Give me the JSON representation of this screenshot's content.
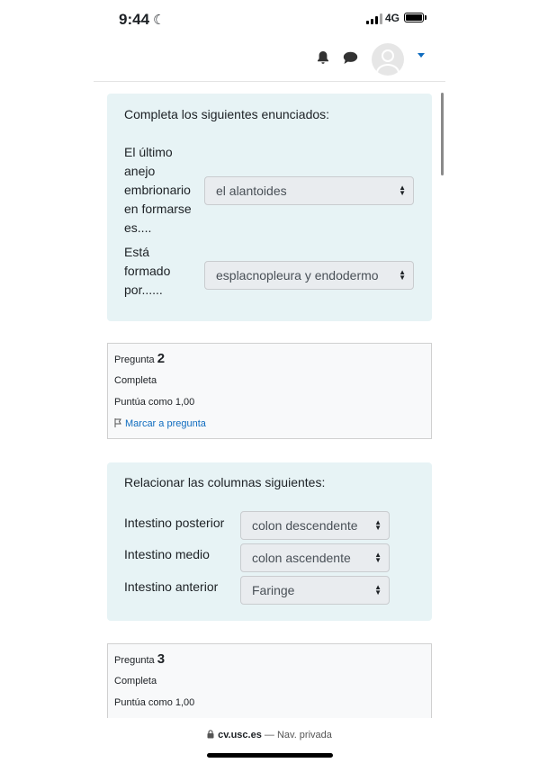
{
  "status_bar": {
    "time": "9:44",
    "network": "4G"
  },
  "icons": {
    "moon": "moon-icon",
    "bell": "bell-icon",
    "chat": "chat-bubble-icon",
    "lock": "lock-icon"
  },
  "question1": {
    "prompt": "Completa los siguientes enunciados:",
    "rows": [
      {
        "label_lines": [
          "El último",
          "anejo",
          "embrionario",
          "en formarse",
          "es...."
        ],
        "selected": "el alantoides"
      },
      {
        "label_lines": [
          "Está",
          "formado",
          "por......"
        ],
        "selected": "esplacnopleura y endodermo"
      }
    ]
  },
  "question2_info": {
    "prefix": "Pregunta",
    "number": "2",
    "state": "Completa",
    "grade": "Puntúa como 1,00",
    "flag_label": "Marcar a pregunta"
  },
  "question2": {
    "prompt": "Relacionar las columnas siguientes:",
    "rows": [
      {
        "label": "Intestino posterior",
        "selected": "colon descendente"
      },
      {
        "label": "Intestino medio",
        "selected": "colon ascendente"
      },
      {
        "label": "Intestino anterior",
        "selected": "Faringe"
      }
    ]
  },
  "question3_info": {
    "prefix": "Pregunta",
    "number": "3",
    "state": "Completa",
    "grade": "Puntúa como 1,00"
  },
  "browser": {
    "domain": "cv.usc.es",
    "suffix": "— Nav. privada"
  },
  "colors": {
    "accent": "#0f6cbf",
    "form_bg": "#e7f3f5"
  }
}
